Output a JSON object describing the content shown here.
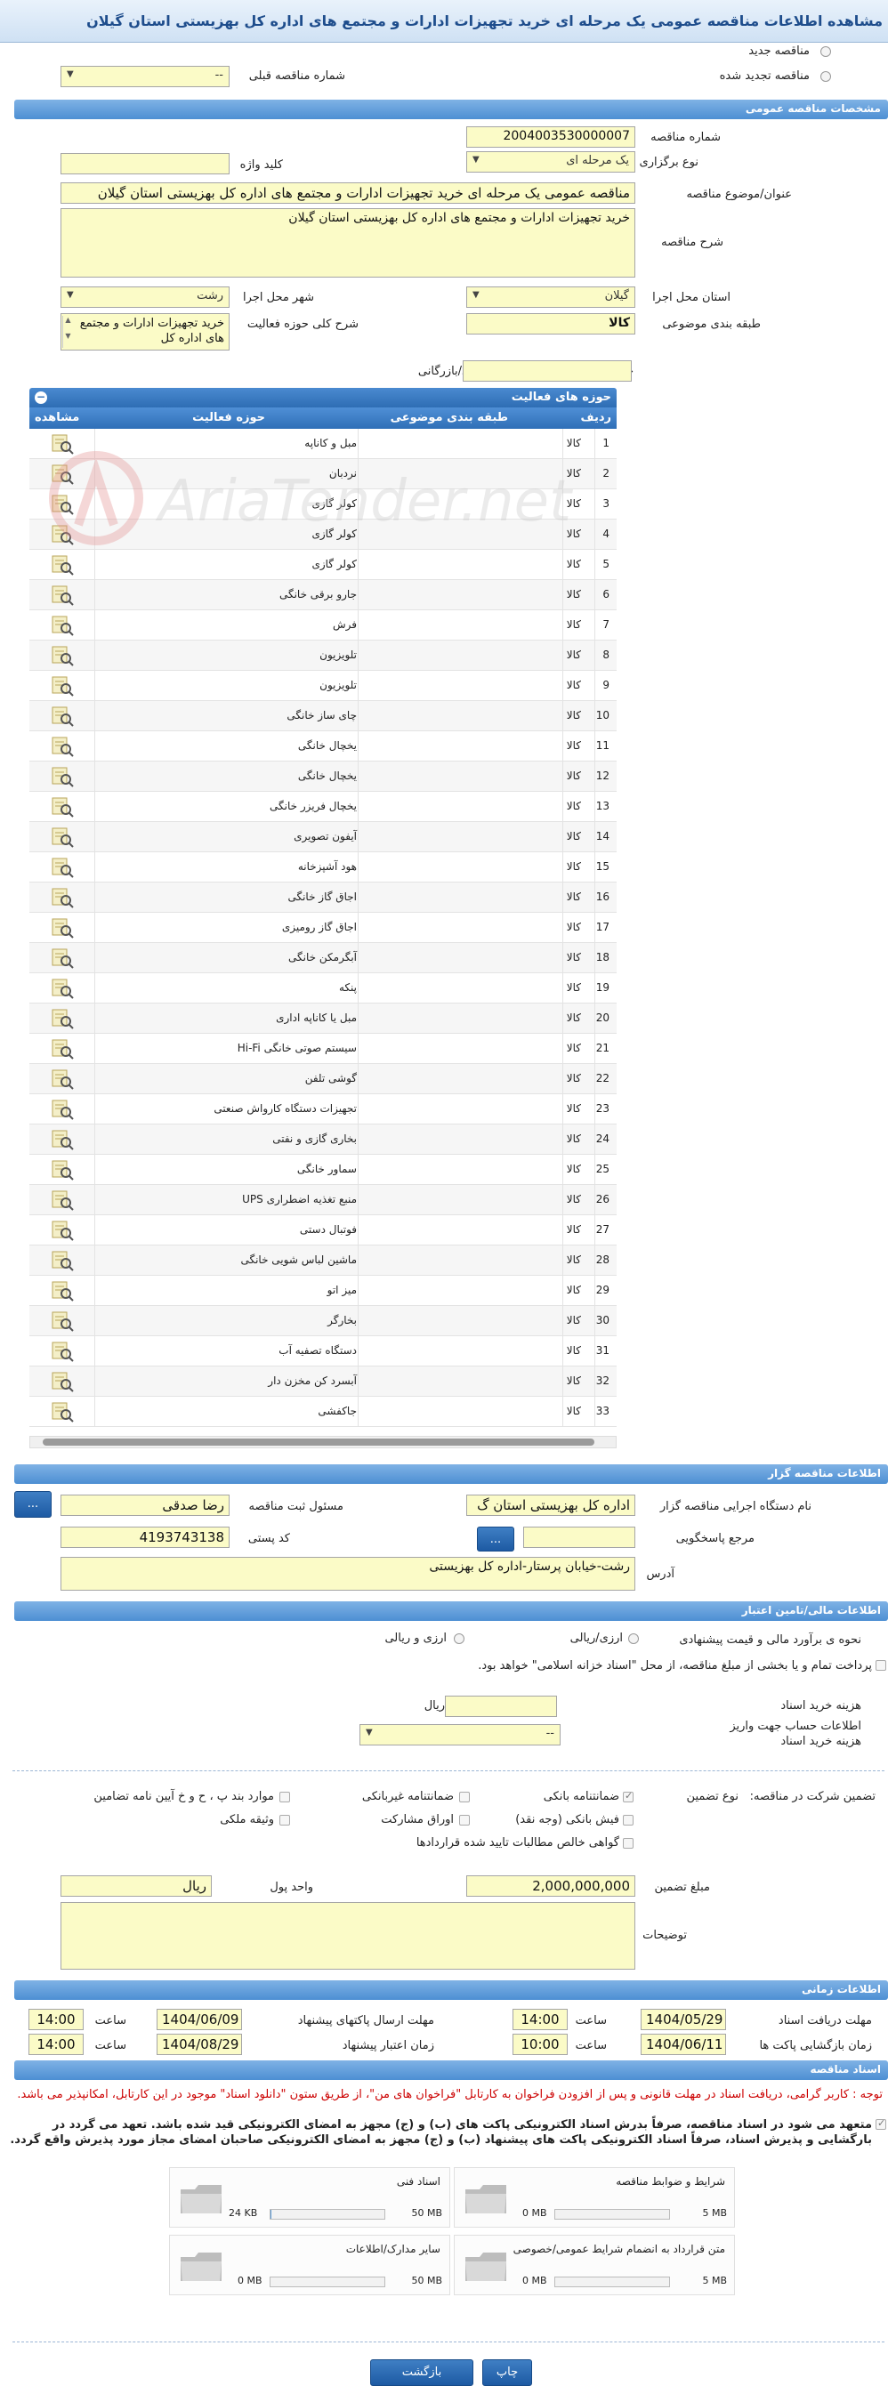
{
  "header": {
    "title": "مشاهده اطلاعات مناقصه عمومی یک مرحله ای خرید تجهیزات ادارات و مجتمع های اداره کل بهزیستی استان گیلان"
  },
  "top": {
    "radio_new": "مناقصه جدید",
    "radio_renewed": "مناقصه تجدید شده",
    "prev_label": "شماره مناقصه قبلی",
    "prev_value": "--"
  },
  "general": {
    "section_title": "مشخصات مناقصه عمومی",
    "number_label": "شماره مناقصه",
    "number_value": "2004003530000007",
    "type_label": "نوع برگزاری",
    "type_value": "یک مرحله ای",
    "keyword_label": "کلید واژه",
    "keyword_value": "",
    "subject_label": "عنوان/موضوع مناقصه",
    "subject_value": "مناقصه عمومی یک مرحله ای خرید تجهیزات ادارات و مجتمع های اداره کل بهزیستی استان گیلان",
    "desc_label": "شرح مناقصه",
    "desc_value": "خرید تجهیزات ادارات و مجتمع های اداره کل بهزیستی استان گیلان",
    "province_label": "استان محل اجرا",
    "province_value": "گیلان",
    "city_label": "شهر محل اجرا",
    "city_value": "رشت",
    "category_label": "طبقه بندی موضوعی",
    "category_value": "کالا",
    "scope_label": "شرح کلی حوزه فعالیت",
    "scope_value": "خرید تجهیزات ادارات و مجتمع های اداره کل",
    "minscore_label": "حداقل امتیاز قابل قبول ارزیابی فنی/بازرگانی",
    "minscore_value": ""
  },
  "activities": {
    "title": "حوزه های فعالیت",
    "col_row": "ردیف",
    "col_category": "طبقه بندی موضوعی",
    "col_activity": "حوزه فعالیت",
    "col_view": "مشاهده",
    "rows": [
      {
        "n": "1",
        "cat": "کالا",
        "act": "مبل و کاناپه"
      },
      {
        "n": "2",
        "cat": "کالا",
        "act": "نردبان"
      },
      {
        "n": "3",
        "cat": "کالا",
        "act": "کولر گازی"
      },
      {
        "n": "4",
        "cat": "کالا",
        "act": "کولر گازی"
      },
      {
        "n": "5",
        "cat": "کالا",
        "act": "کولر گازی"
      },
      {
        "n": "6",
        "cat": "کالا",
        "act": "جارو برقی خانگی"
      },
      {
        "n": "7",
        "cat": "کالا",
        "act": "فرش"
      },
      {
        "n": "8",
        "cat": "کالا",
        "act": "تلویزیون"
      },
      {
        "n": "9",
        "cat": "کالا",
        "act": "تلویزیون"
      },
      {
        "n": "10",
        "cat": "کالا",
        "act": "چای ساز خانگی"
      },
      {
        "n": "11",
        "cat": "کالا",
        "act": "یخچال خانگی"
      },
      {
        "n": "12",
        "cat": "کالا",
        "act": "یخچال خانگی"
      },
      {
        "n": "13",
        "cat": "کالا",
        "act": "یخچال فریزر خانگی"
      },
      {
        "n": "14",
        "cat": "کالا",
        "act": "آیفون تصویری"
      },
      {
        "n": "15",
        "cat": "کالا",
        "act": "هود آشپزخانه"
      },
      {
        "n": "16",
        "cat": "کالا",
        "act": "اجاق گاز خانگی"
      },
      {
        "n": "17",
        "cat": "کالا",
        "act": "اجاق گاز رومیزی"
      },
      {
        "n": "18",
        "cat": "کالا",
        "act": "آبگرمکن خانگی"
      },
      {
        "n": "19",
        "cat": "کالا",
        "act": "پنکه"
      },
      {
        "n": "20",
        "cat": "کالا",
        "act": "مبل یا کاناپه اداری"
      },
      {
        "n": "21",
        "cat": "کالا",
        "act": "سیستم صوتی خانگی Hi-Fi"
      },
      {
        "n": "22",
        "cat": "کالا",
        "act": "گوشی تلفن"
      },
      {
        "n": "23",
        "cat": "کالا",
        "act": "تجهیزات دستگاه کارواش صنعتی"
      },
      {
        "n": "24",
        "cat": "کالا",
        "act": "بخاری گازی و نفتی"
      },
      {
        "n": "25",
        "cat": "کالا",
        "act": "سماور خانگی"
      },
      {
        "n": "26",
        "cat": "کالا",
        "act": "منبع تغذیه اضطراری UPS"
      },
      {
        "n": "27",
        "cat": "کالا",
        "act": "فوتبال دستی"
      },
      {
        "n": "28",
        "cat": "کالا",
        "act": "ماشین لباس شویی خانگی"
      },
      {
        "n": "29",
        "cat": "کالا",
        "act": "میز اتو"
      },
      {
        "n": "30",
        "cat": "کالا",
        "act": "بخارگر"
      },
      {
        "n": "31",
        "cat": "کالا",
        "act": "دستگاه تصفیه آب"
      },
      {
        "n": "32",
        "cat": "کالا",
        "act": "آبسرد کن مخزن دار"
      },
      {
        "n": "33",
        "cat": "کالا",
        "act": "جاکفشی"
      }
    ]
  },
  "organizer": {
    "section_title": "اطلاعات مناقصه گزار",
    "org_label": "نام دستگاه اجرایی مناقصه گزار",
    "org_value": "اداره کل بهزیستی استان گ",
    "responsible_label": "مسئول ثبت مناقصه",
    "responsible_value": "رضا صدقی",
    "reference_label": "مرجع پاسخگویی",
    "reference_value": "",
    "postal_label": "کد پستی",
    "postal_value": "4193743138",
    "address_label": "آدرس",
    "address_value": "رشت-خیابان پرستار-اداره کل بهزیستی",
    "btn_dots": "..."
  },
  "financial": {
    "section_title": "اطلاعات مالی/تامین اعتبار",
    "estimate_label": "نحوه ی برآورد مالی و قیمت پیشنهادی",
    "opt_rial_fx": "ارزی/ریالی",
    "opt_fx_and_rial": "ارزی و ریالی",
    "treasury_text": "پرداخت تمام و یا بخشی از مبلغ مناقصه، از محل \"اسناد خزانه اسلامی\" خواهد بود.",
    "doc_fee_label": "هزینه خرید اسناد",
    "doc_fee_unit": "ریال",
    "account_label": "اطلاعات حساب جهت واریز هزینه خرید اسناد",
    "account_value": "--",
    "guarantee_label": "تضمین شرکت در مناقصه:",
    "guarantee_type_label": "نوع تضمین",
    "g1": "ضمانتنامه بانکی",
    "g2": "ضمانتنامه غیربانکی",
    "g3": "موارد بند پ ، ح و خ آیین نامه تضامین",
    "g4": "فیش بانکی (وجه نقد)",
    "g5": "اوراق مشارکت",
    "g6": "وثیقه ملکی",
    "g7": "گواهی خالص مطالبات تایید شده قراردادها",
    "amount_label": "مبلغ تضمین",
    "amount_value": "2,000,000,000",
    "currency_label": "واحد پول",
    "currency_value": "ریال",
    "notes_label": "توضیحات",
    "notes_value": ""
  },
  "timing": {
    "section_title": "اطلاعات زمانی",
    "receive_label": "مهلت دریافت اسناد",
    "receive_date": "1404/05/29",
    "receive_time": "14:00",
    "send_label": "مهلت ارسال پاکتهای پیشنهاد",
    "send_date": "1404/06/09",
    "send_time": "14:00",
    "open_label": "زمان بازگشایی پاکت ها",
    "open_date": "1404/06/11",
    "open_time": "10:00",
    "valid_label": "زمان اعتبار پیشنهاد",
    "valid_date": "1404/08/29",
    "valid_time": "14:00",
    "time_label": "ساعت"
  },
  "documents": {
    "section_title": "اسناد مناقصه",
    "note_red": "توجه : کاربر گرامی، دریافت اسناد در مهلت قانونی و پس از افزودن فراخوان به کارتابل \"فراخوان های من\"، از طریق ستون \"دانلود اسناد\" موجود در این کارتابل، امکانپذیر می باشد.",
    "note_bold": "متعهد می شود در اسناد مناقصه، صرفاً بدرش اسناد الکترونیکی پاکت های (ب) و (ج) مجهز به امضای الکترونیکی قید شده باشد. تعهد می گردد در بارگشایی و پذیرش اسناد، صرفاً اسناد الکترونیکی پاکت های پیشنهاد (ب) و (ج) مجهز به امضای الکترونیکی صاحبان امضای مجاز مورد پذیرش واقع گردد.",
    "files": [
      {
        "name": "شرایط و ضوابط مناقصه",
        "used": "0 MB",
        "max": "5 MB",
        "fill": 0
      },
      {
        "name": "اسناد فنی",
        "used": "24 KB",
        "max": "50 MB",
        "fill": 0.01
      },
      {
        "name": "متن قرارداد به انضمام شرایط عمومی/خصوصی",
        "used": "0 MB",
        "max": "5 MB",
        "fill": 0
      },
      {
        "name": "سایر مدارک/اطلاعات",
        "used": "0 MB",
        "max": "50 MB",
        "fill": 0
      }
    ]
  },
  "footer": {
    "print_label": "چاپ",
    "back_label": "بازگشت"
  },
  "watermark": "AriaTender.net",
  "colors": {
    "section": "#4d8fd3",
    "field": "#fbfbc7",
    "title": "#1e4d8c",
    "note_red": "#cc0000"
  }
}
